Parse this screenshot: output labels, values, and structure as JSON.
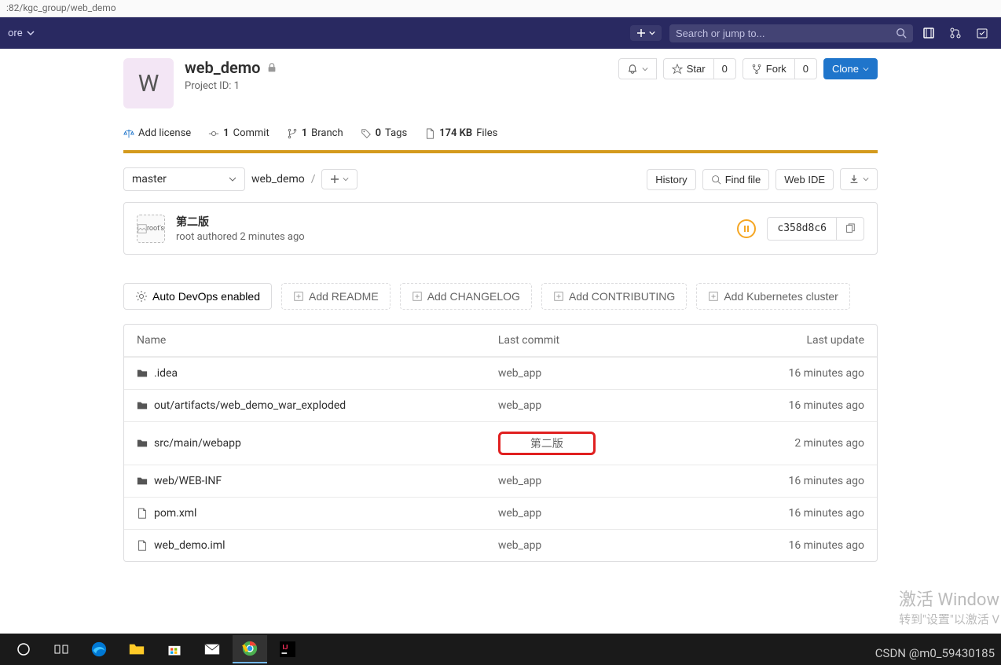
{
  "url_fragment": ":82/kgc_group/web_demo",
  "top_nav": {
    "more": "ore",
    "search_placeholder": "Search or jump to..."
  },
  "project": {
    "avatar_letter": "W",
    "name": "web_demo",
    "id_label": "Project ID: 1",
    "notify": "",
    "star_label": "Star",
    "star_count": "0",
    "fork_label": "Fork",
    "fork_count": "0",
    "clone_label": "Clone"
  },
  "stats": {
    "add_license": "Add license",
    "commits_n": "1",
    "commits_label": "Commit",
    "branches_n": "1",
    "branches_label": "Branch",
    "tags_n": "0",
    "tags_label": "Tags",
    "size": "174 KB",
    "size_label": "Files"
  },
  "controls": {
    "branch": "master",
    "crumb": "web_demo",
    "history": "History",
    "find_file": "Find file",
    "web_ide": "Web IDE"
  },
  "commit": {
    "avatar_alt": "root's",
    "message": "第二版",
    "author": "root",
    "authored": "authored",
    "time": "2 minutes ago",
    "sha": "c358d8c6"
  },
  "actions": {
    "auto_devops": "Auto DevOps enabled",
    "add_readme": "Add README",
    "add_changelog": "Add CHANGELOG",
    "add_contributing": "Add CONTRIBUTING",
    "add_k8s": "Add Kubernetes cluster"
  },
  "table": {
    "h_name": "Name",
    "h_commit": "Last commit",
    "h_update": "Last update",
    "rows": [
      {
        "type": "folder",
        "name": ".idea",
        "commit": "web_app",
        "update": "16 minutes ago",
        "hl": false
      },
      {
        "type": "folder",
        "name": "out/artifacts/web_demo_war_exploded",
        "commit": "web_app",
        "update": "16 minutes ago",
        "hl": false
      },
      {
        "type": "folder",
        "name": "src/main/webapp",
        "commit": "第二版",
        "update": "2 minutes ago",
        "hl": true
      },
      {
        "type": "folder",
        "name": "web/WEB-INF",
        "commit": "web_app",
        "update": "16 minutes ago",
        "hl": false
      },
      {
        "type": "file",
        "name": "pom.xml",
        "commit": "web_app",
        "update": "16 minutes ago",
        "hl": false
      },
      {
        "type": "file",
        "name": "web_demo.iml",
        "commit": "web_app",
        "update": "16 minutes ago",
        "hl": false
      }
    ]
  },
  "watermark": {
    "line1": "激活 Window",
    "line2": "转到\"设置\"以激活 V"
  },
  "csdn": "CSDN @m0_59430185"
}
